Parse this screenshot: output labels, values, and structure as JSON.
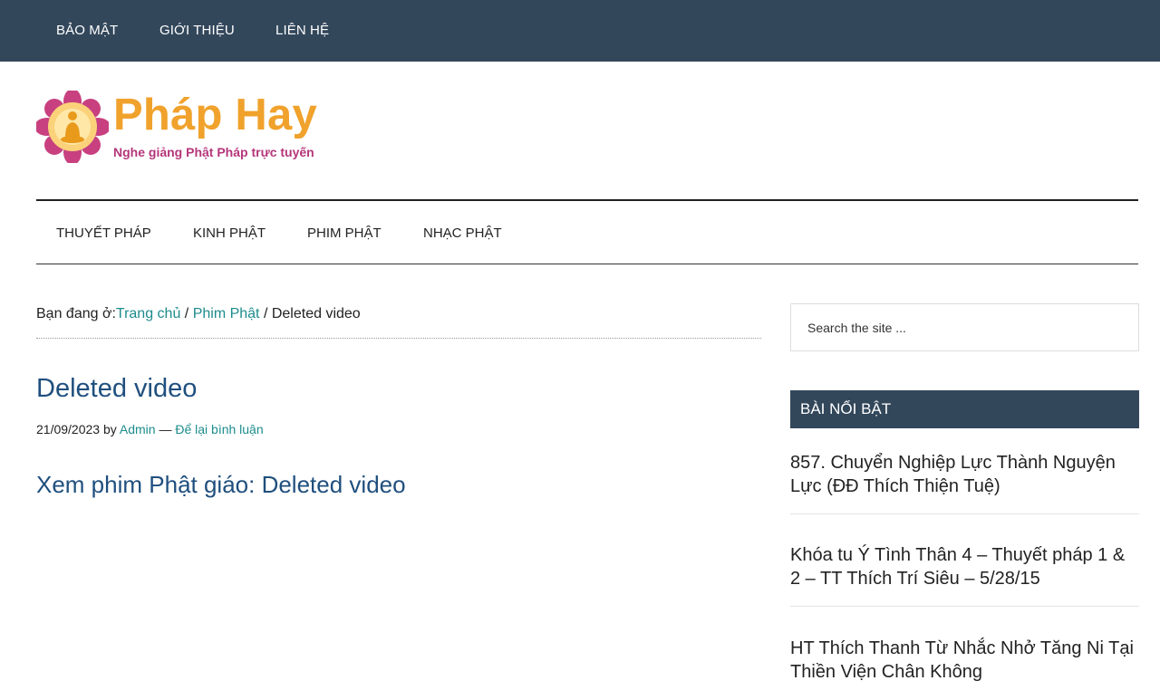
{
  "top_nav": [
    "BẢO MẬT",
    "GIỚI THIỆU",
    "LIÊN HỆ"
  ],
  "logo": {
    "title": "Pháp Hay",
    "tagline": "Nghe giảng Phật Pháp trực tuyến"
  },
  "main_nav": [
    "THUYẾT PHÁP",
    "KINH PHẬT",
    "PHIM PHẬT",
    "NHẠC PHẬT"
  ],
  "breadcrumb": {
    "prefix": "Bạn đang ở:",
    "home": "Trang chủ",
    "sep": " / ",
    "category": "Phim Phật",
    "current": "Deleted video"
  },
  "post": {
    "title": "Deleted video",
    "date": "21/09/2023",
    "by": " by ",
    "author": "Admin",
    "dash": " — ",
    "comment_link": "Để lại bình luận",
    "subtitle": "Xem phim Phật giáo: Deleted video"
  },
  "sidebar": {
    "search_placeholder": "Search the site ...",
    "widget_title": "BÀI NỔI BẬT",
    "featured": [
      "857. Chuyển Nghiệp Lực Thành Nguyện Lực (ĐĐ Thích Thiện Tuệ)",
      "Khóa tu Ý Tình Thân 4 – Thuyết pháp 1 & 2 – TT Thích Trí Siêu – 5/28/15",
      "HT Thích Thanh Từ Nhắc Nhở Tăng Ni Tại Thiền Viện Chân Không"
    ]
  },
  "colors": {
    "topbar": "#33475b",
    "logo_title": "#f0a22c",
    "logo_tagline": "#b5367a",
    "link": "#1d8c8c",
    "heading": "#1f4f7e"
  }
}
